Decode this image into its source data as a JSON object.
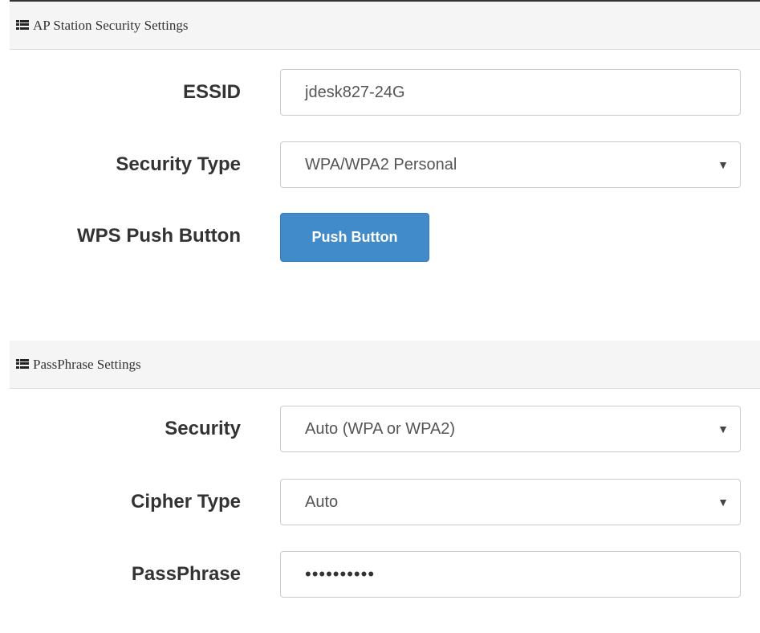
{
  "ap_station_panel": {
    "title": "AP Station Security Settings",
    "essid_label": "ESSID",
    "essid_value": "jdesk827-24G",
    "security_type_label": "Security Type",
    "security_type_value": "WPA/WPA2 Personal",
    "wps_label": "WPS Push Button",
    "wps_button_label": "Push Button"
  },
  "passphrase_panel": {
    "title": "PassPhrase Settings",
    "security_label": "Security",
    "security_value": "Auto (WPA or WPA2)",
    "cipher_label": "Cipher Type",
    "cipher_value": "Auto",
    "passphrase_label": "PassPhrase",
    "passphrase_value": "••••••••••"
  },
  "icons": {
    "panel_heading_icon": "list-icon",
    "select_arrow": "caret-down-icon"
  },
  "colors": {
    "primary_button": "#428bca",
    "heading_bg": "#f5f5f5",
    "label_text": "#333333"
  }
}
